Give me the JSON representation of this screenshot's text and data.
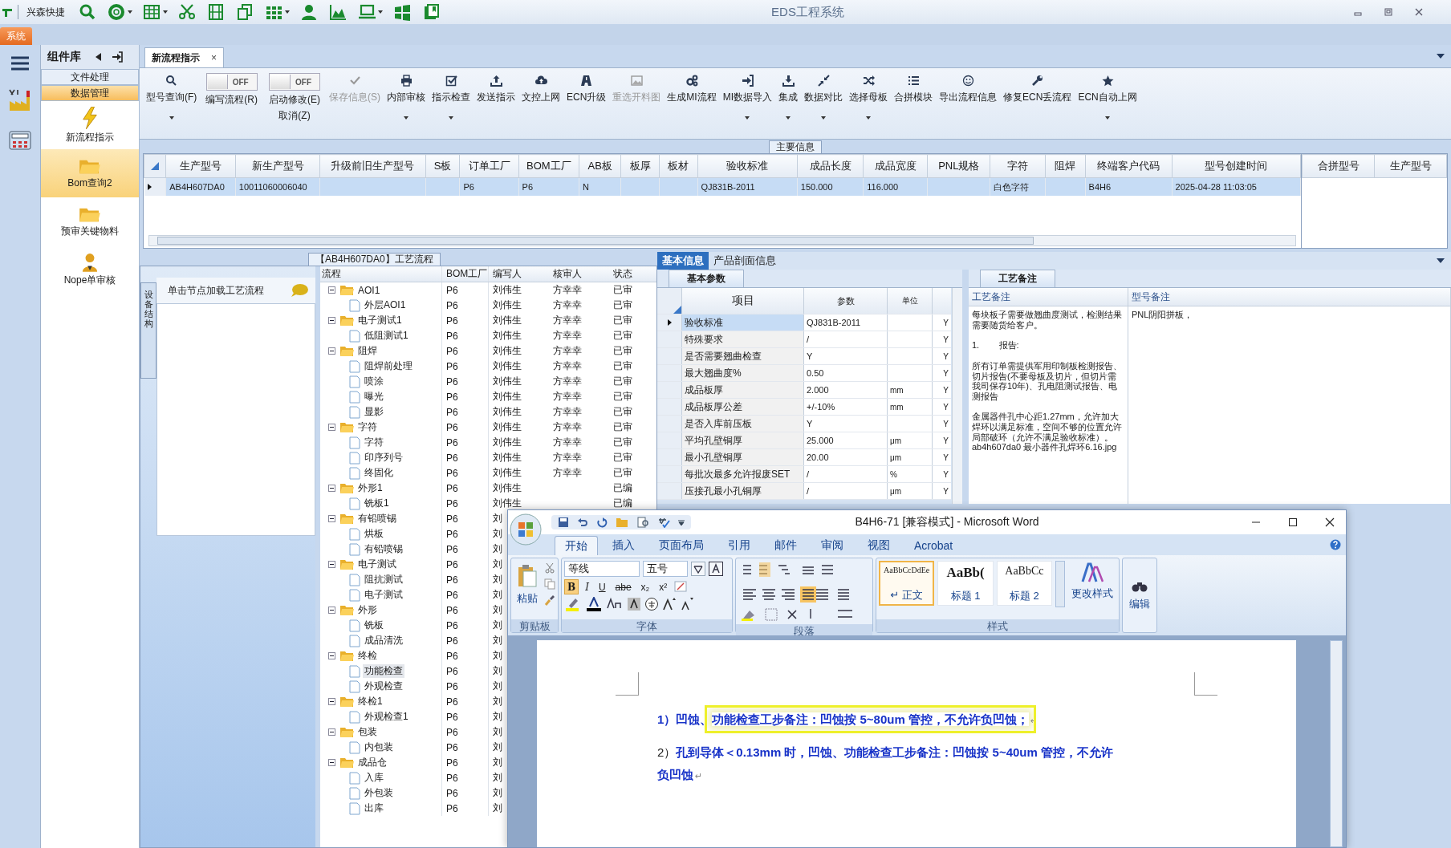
{
  "window": {
    "app_label": "兴森快捷",
    "title": "EDS工程系统"
  },
  "menu_tabs": [
    {
      "label": "系统",
      "selected": true
    }
  ],
  "nav": {
    "title": "组件库",
    "groups": [
      {
        "label": "文件处理",
        "selected": false
      },
      {
        "label": "数据管理",
        "selected": true
      }
    ],
    "items": [
      {
        "label": "新流程指示",
        "selected": false
      },
      {
        "label": "Bom查询2",
        "selected": true
      },
      {
        "label": "预审关键物料",
        "selected": false
      },
      {
        "label": "Nope单审核",
        "selected": false
      }
    ]
  },
  "doc_tabs": [
    {
      "label": "新流程指示",
      "selected": true,
      "close": "×"
    }
  ],
  "toolbar": [
    {
      "kind": "button",
      "label": "型号查询(F)",
      "dropdown": true,
      "disabled": false
    },
    {
      "kind": "toggle",
      "state": "OFF",
      "on": false,
      "lines": [
        "编写流程(R)"
      ]
    },
    {
      "kind": "toggle",
      "state": "OFF",
      "on": false,
      "lines": [
        "启动修改(E)",
        "取消(Z)"
      ]
    },
    {
      "kind": "button",
      "label": "保存信息(S)",
      "dropdown": false,
      "disabled": true
    },
    {
      "kind": "button",
      "label": "内部审核",
      "dropdown": true,
      "disabled": false
    },
    {
      "kind": "button",
      "label": "指示检查",
      "dropdown": true,
      "disabled": false
    },
    {
      "kind": "button",
      "label": "发送指示",
      "dropdown": false,
      "disabled": false
    },
    {
      "kind": "button",
      "label": "文控上网",
      "dropdown": false,
      "disabled": false
    },
    {
      "kind": "button",
      "label": "ECN升级",
      "dropdown": false,
      "disabled": false
    },
    {
      "kind": "button",
      "label": "重选开料图",
      "dropdown": false,
      "disabled": true
    },
    {
      "kind": "button",
      "label": "生成MI流程",
      "dropdown": false,
      "disabled": false
    },
    {
      "kind": "button",
      "label": "MI数据导入",
      "dropdown": true,
      "disabled": false
    },
    {
      "kind": "button",
      "label": "集成",
      "dropdown": true,
      "disabled": false
    },
    {
      "kind": "button",
      "label": "数据对比",
      "dropdown": true,
      "disabled": false
    },
    {
      "kind": "button",
      "label": "选择母板",
      "dropdown": true,
      "disabled": false
    },
    {
      "kind": "button",
      "label": "合拼模块",
      "dropdown": false,
      "disabled": false
    },
    {
      "kind": "button",
      "label": "导出流程信息",
      "dropdown": false,
      "disabled": false
    },
    {
      "kind": "button",
      "label": "修复ECN丢流程",
      "dropdown": false,
      "disabled": false
    },
    {
      "kind": "button",
      "label": "ECN自动上网",
      "dropdown": true,
      "disabled": false
    }
  ],
  "main_info": {
    "title": "主要信息",
    "columns": [
      "生产型号",
      "新生产型号",
      "升级前旧生产型号",
      "S板",
      "订单工厂",
      "BOM工厂",
      "AB板",
      "板厚",
      "板材",
      "验收标准",
      "成品长度",
      "成品宽度",
      "PNL规格",
      "字符",
      "阻焊",
      "终端客户代码",
      "型号创建时间"
    ],
    "rows": [
      {
        "selected": true,
        "cells": [
          "AB4H607DA0",
          "10011060006040",
          null,
          null,
          "P6",
          "P6",
          "N",
          null,
          null,
          "QJ831B-2011",
          "150.000",
          "116.000",
          null,
          "白色字符",
          null,
          "B4H6",
          "2025-04-28 11:03:05"
        ]
      }
    ],
    "side_columns": [
      "合拼型号",
      "生产型号"
    ]
  },
  "process": {
    "title": "【AB4H607DA0】工艺流程",
    "side_tab": "设备结构",
    "hint": "单击节点加载工艺流程",
    "columns": [
      "流程",
      "BOM工厂",
      "编写人",
      "核审人",
      "状态"
    ],
    "tree": [
      {
        "name": "AOI1",
        "factory": "P6",
        "writer": "刘伟生",
        "reviewer": "方幸幸",
        "status": "已审",
        "expanded": true,
        "selected": false,
        "children": [
          {
            "name": "外层AOI1",
            "factory": "P6",
            "writer": "刘伟生",
            "reviewer": "方幸幸",
            "status": "已审",
            "selected": false
          }
        ]
      },
      {
        "name": "电子测试1",
        "factory": "P6",
        "writer": "刘伟生",
        "reviewer": "方幸幸",
        "status": "已审",
        "expanded": true,
        "selected": false,
        "children": [
          {
            "name": "低阻测试1",
            "factory": "P6",
            "writer": "刘伟生",
            "reviewer": "方幸幸",
            "status": "已审",
            "selected": false
          }
        ]
      },
      {
        "name": "阻焊",
        "factory": "P6",
        "writer": "刘伟生",
        "reviewer": "方幸幸",
        "status": "已审",
        "expanded": true,
        "selected": false,
        "children": [
          {
            "name": "阻焊前处理",
            "factory": "P6",
            "writer": "刘伟生",
            "reviewer": "方幸幸",
            "status": "已审",
            "selected": false
          },
          {
            "name": "喷涂",
            "factory": "P6",
            "writer": "刘伟生",
            "reviewer": "方幸幸",
            "status": "已审",
            "selected": false
          },
          {
            "name": "曝光",
            "factory": "P6",
            "writer": "刘伟生",
            "reviewer": "方幸幸",
            "status": "已审",
            "selected": false
          },
          {
            "name": "显影",
            "factory": "P6",
            "writer": "刘伟生",
            "reviewer": "方幸幸",
            "status": "已审",
            "selected": false
          }
        ]
      },
      {
        "name": "字符",
        "factory": "P6",
        "writer": "刘伟生",
        "reviewer": "方幸幸",
        "status": "已审",
        "expanded": true,
        "selected": false,
        "children": [
          {
            "name": "字符",
            "factory": "P6",
            "writer": "刘伟生",
            "reviewer": "方幸幸",
            "status": "已审",
            "selected": false
          },
          {
            "name": "印序列号",
            "factory": "P6",
            "writer": "刘伟生",
            "reviewer": "方幸幸",
            "status": "已审",
            "selected": false
          },
          {
            "name": "终固化",
            "factory": "P6",
            "writer": "刘伟生",
            "reviewer": "方幸幸",
            "status": "已审",
            "selected": false
          }
        ]
      },
      {
        "name": "外形1",
        "factory": "P6",
        "writer": "刘伟生",
        "status": "已编",
        "expanded": true,
        "selected": false,
        "children": [
          {
            "name": "铣板1",
            "factory": "P6",
            "writer": "刘伟生",
            "status": "已编",
            "selected": false
          }
        ]
      },
      {
        "name": "有铅喷锡",
        "factory": "P6",
        "writer": "刘",
        "expanded": true,
        "selected": false,
        "children": [
          {
            "name": "烘板",
            "factory": "P6",
            "writer": "刘",
            "selected": false
          },
          {
            "name": "有铅喷锡",
            "factory": "P6",
            "writer": "刘",
            "selected": false
          }
        ]
      },
      {
        "name": "电子测试",
        "factory": "P6",
        "writer": "刘",
        "expanded": true,
        "selected": false,
        "children": [
          {
            "name": "阻抗测试",
            "factory": "P6",
            "writer": "刘",
            "selected": false
          },
          {
            "name": "电子测试",
            "factory": "P6",
            "writer": "刘",
            "selected": false
          }
        ]
      },
      {
        "name": "外形",
        "factory": "P6",
        "writer": "刘",
        "expanded": true,
        "selected": false,
        "children": [
          {
            "name": "铣板",
            "factory": "P6",
            "writer": "刘",
            "selected": false
          },
          {
            "name": "成品清洗",
            "factory": "P6",
            "writer": "刘",
            "selected": false
          }
        ]
      },
      {
        "name": "终检",
        "factory": "P6",
        "writer": "刘",
        "expanded": true,
        "selected": false,
        "children": [
          {
            "name": "功能检查",
            "factory": "P6",
            "writer": "刘",
            "selected": true
          },
          {
            "name": "外观检查",
            "factory": "P6",
            "writer": "刘",
            "selected": false
          }
        ]
      },
      {
        "name": "终检1",
        "factory": "P6",
        "writer": "刘",
        "expanded": true,
        "selected": false,
        "children": [
          {
            "name": "外观检查1",
            "factory": "P6",
            "writer": "刘",
            "selected": false
          }
        ]
      },
      {
        "name": "包装",
        "factory": "P6",
        "writer": "刘",
        "expanded": true,
        "selected": false,
        "children": [
          {
            "name": "内包装",
            "factory": "P6",
            "writer": "刘",
            "selected": false
          }
        ]
      },
      {
        "name": "成品仓",
        "factory": "P6",
        "writer": "刘",
        "expanded": true,
        "selected": false,
        "children": [
          {
            "name": "入库",
            "factory": "P6",
            "writer": "刘",
            "selected": false
          },
          {
            "name": "外包装",
            "factory": "P6",
            "writer": "刘",
            "selected": false
          },
          {
            "name": "出库",
            "factory": "P6",
            "writer": "刘",
            "selected": false
          }
        ]
      }
    ]
  },
  "detail": {
    "tabs": [
      {
        "label": "基本信息",
        "selected": true
      },
      {
        "label": "产品剖面信息",
        "selected": false
      }
    ],
    "params": {
      "tab": "基本参数",
      "columns": [
        "项目",
        "参数",
        "单位"
      ],
      "rows": [
        {
          "item": "验收标准",
          "value": "QJ831B-2011",
          "column_4": "Y",
          "selected": true
        },
        {
          "item": "特殊要求",
          "value": "/",
          "column_4": "Y",
          "selected": false
        },
        {
          "item": "是否需要翘曲检查",
          "value": "Y",
          "column_4": "Y",
          "selected": false
        },
        {
          "item": "最大翘曲度%",
          "value": "0.50",
          "column_4": "Y",
          "selected": false
        },
        {
          "item": "成品板厚",
          "value": "2.000",
          "unit": "mm",
          "column_4": "Y",
          "selected": false
        },
        {
          "item": "成品板厚公差",
          "value": "+/-10%",
          "unit": "mm",
          "column_4": "Y",
          "selected": false
        },
        {
          "item": "是否入库前压板",
          "value": "Y",
          "column_4": "Y",
          "selected": false
        },
        {
          "item": "平均孔壁铜厚",
          "value": "25.000",
          "unit": "μm",
          "column_4": "Y",
          "selected": false
        },
        {
          "item": "最小孔壁铜厚",
          "value": "20.00",
          "unit": "μm",
          "column_4": "Y",
          "selected": false
        },
        {
          "item": "每批次最多允许报废SET",
          "value": "/",
          "unit": "%",
          "column_4": "Y",
          "selected": false
        },
        {
          "item": "压接孔最小孔铜厚",
          "value": "/",
          "unit": "μm",
          "column_4": "Y",
          "selected": false
        }
      ]
    },
    "notes": {
      "tab": "工艺备注",
      "columns": [
        "工艺备注",
        "型号备注"
      ],
      "process_note": [
        "每块板子需要做翘曲度测试，检测结果需要随货给客户。",
        "1.        报告:",
        "所有订单需提供军用印制板检测报告、切片报告(不要母板及切片，但切片需我司保存10年)、孔电阻测试报告、电测报告",
        "金属器件孔中心距1.27mm，允许加大焊环以满足标准，空间不够的位置允许局部破环（允许不满足验收标准）。ab4h607da0 最小器件孔焊环6.16.jpg"
      ],
      "model_note": "PNL阴阳拼板，"
    }
  },
  "word": {
    "title": "B4H6-71 [兼容模式] - Microsoft Word",
    "tabs": [
      {
        "label": "开始",
        "selected": true
      },
      {
        "label": "插入",
        "selected": false
      },
      {
        "label": "页面布局",
        "selected": false
      },
      {
        "label": "引用",
        "selected": false
      },
      {
        "label": "邮件",
        "selected": false
      },
      {
        "label": "审阅",
        "selected": false
      },
      {
        "label": "视图",
        "selected": false
      },
      {
        "label": "Acrobat",
        "selected": false
      }
    ],
    "clipboard": {
      "paste": "粘贴",
      "label": "剪贴板"
    },
    "font": {
      "name": "等线",
      "size": "五号",
      "label": "字体",
      "buttons": [
        {
          "text": "B",
          "selected": true
        },
        {
          "text": "I",
          "selected": false
        },
        {
          "text": "U",
          "selected": false
        },
        {
          "text": "abe",
          "selected": false
        },
        {
          "text": "x₂",
          "selected": false
        },
        {
          "text": "x²",
          "selected": false
        }
      ]
    },
    "paragraph": {
      "label": "段落"
    },
    "styles": {
      "label": "样式",
      "items": [
        {
          "preview": "AaBbCcDdEe",
          "name": "↵ 正文",
          "selected": true
        },
        {
          "preview": "AaBb(",
          "name": "标题 1",
          "selected": false
        },
        {
          "preview": "AaBbCc",
          "name": "标题 2",
          "selected": false
        }
      ],
      "change": "更改样式"
    },
    "editing": "编辑",
    "document": [
      {
        "segments": [
          {
            "text": "1）凹蚀、",
            "emphasis": true,
            "boxed": false
          },
          {
            "text": "功能检查工步备注：凹蚀按 5~80um 管控，不允许负凹蚀；",
            "emphasis": true,
            "boxed": true
          }
        ],
        "mark": "↵"
      },
      {
        "segments": [
          {
            "text": "2）",
            "emphasis": false,
            "boxed": false
          },
          {
            "text": "孔到导体＜0.13mm 时，凹蚀、功能检查工步备注：凹蚀按 5~40um 管控，不允许负凹蚀",
            "emphasis": true,
            "boxed": false
          }
        ],
        "mark": "↵"
      }
    ]
  }
}
